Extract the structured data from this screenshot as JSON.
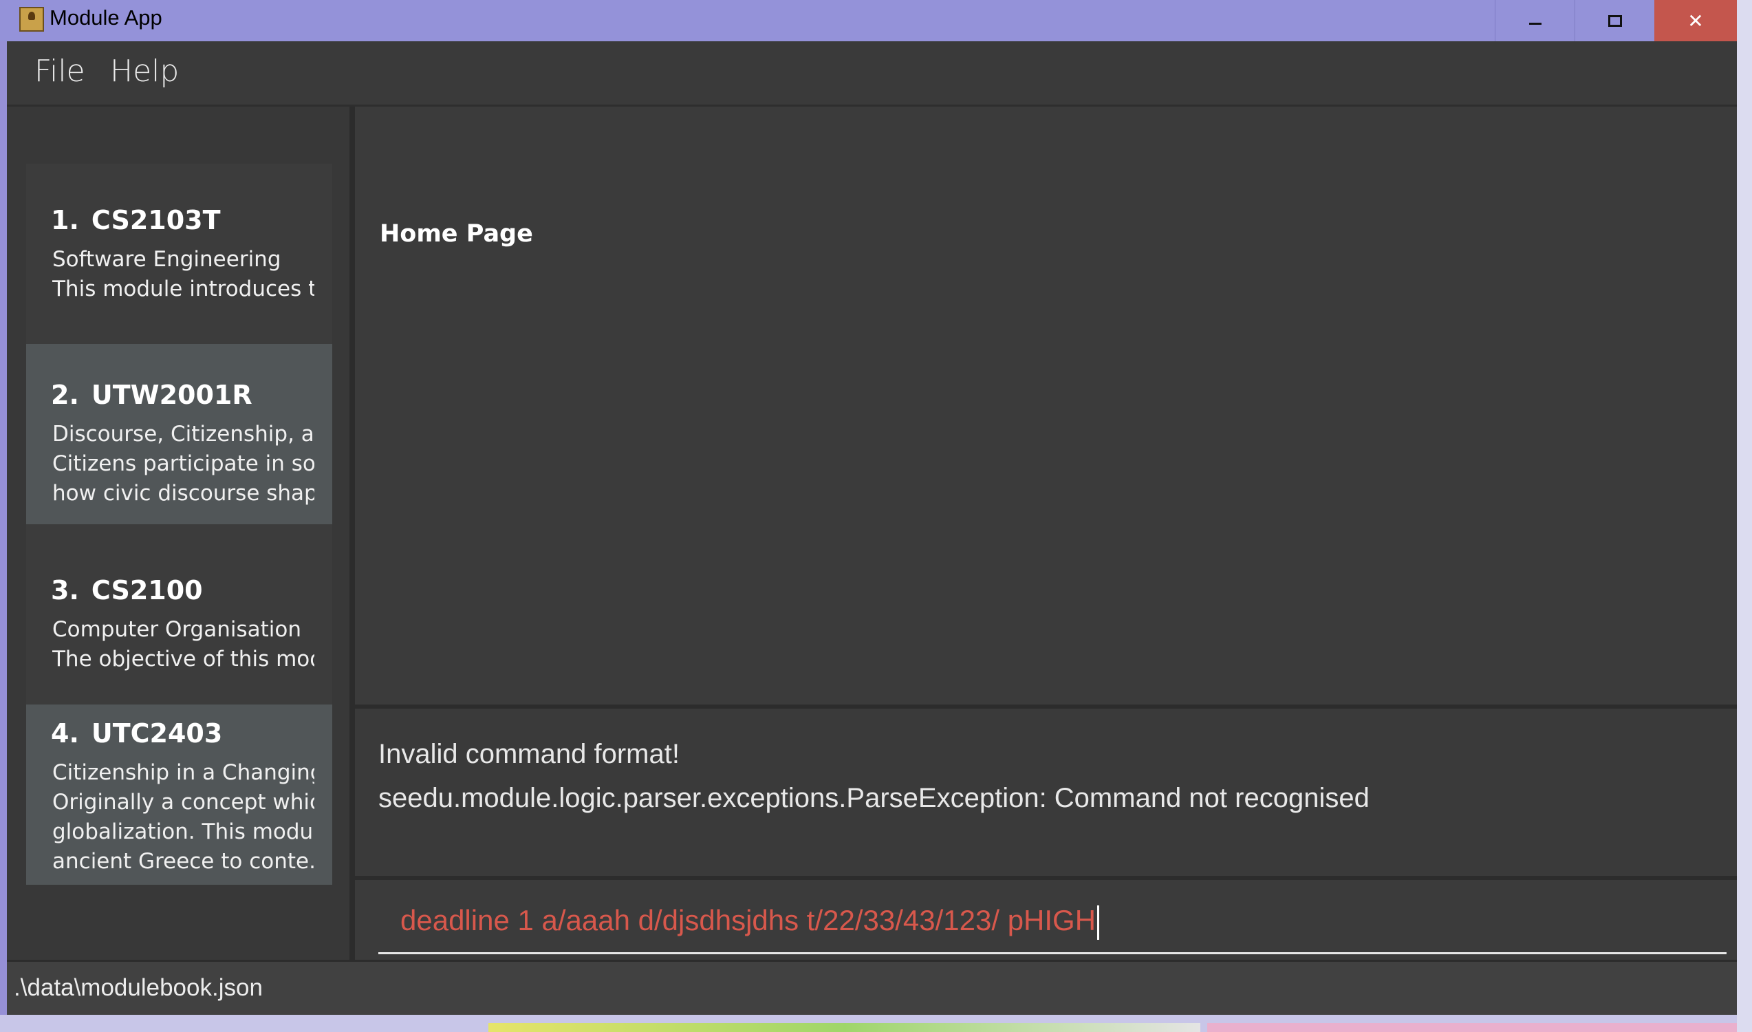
{
  "window": {
    "title": "Module App",
    "minimize_icon": "minimize-icon",
    "maximize_icon": "maximize-icon",
    "close_icon": "close-icon",
    "close_glyph": "✕"
  },
  "menu": {
    "file": "File",
    "help": "Help"
  },
  "modules": [
    {
      "index": "1.",
      "code": "CS2103T",
      "lines": [
        "Software Engineering",
        "This module introduces t..."
      ]
    },
    {
      "index": "2.",
      "code": "UTW2001R",
      "lines": [
        "Discourse, Citizenship, an...",
        "Citizens participate in soc...",
        "how civic discourse shap..."
      ]
    },
    {
      "index": "3.",
      "code": "CS2100",
      "lines": [
        "Computer Organisation",
        "The objective of this mod..."
      ]
    },
    {
      "index": "4.",
      "code": "UTC2403",
      "lines": [
        "Citizenship in a Changing...",
        "Originally a concept whic...",
        "globalization. This modul...",
        "ancient Greece to conte..."
      ]
    }
  ],
  "main": {
    "title": "Home Page"
  },
  "result": {
    "line1": "Invalid command format!",
    "line2": "seedu.module.logic.parser.exceptions.ParseException: Command not recognised"
  },
  "command": {
    "value": "deadline 1 a/aaah d/djsdhsjdhs t/22/33/43/123/ pHIGH",
    "text_color": "#d8584c"
  },
  "status": {
    "file_path": ".\\data\\modulebook.json"
  }
}
